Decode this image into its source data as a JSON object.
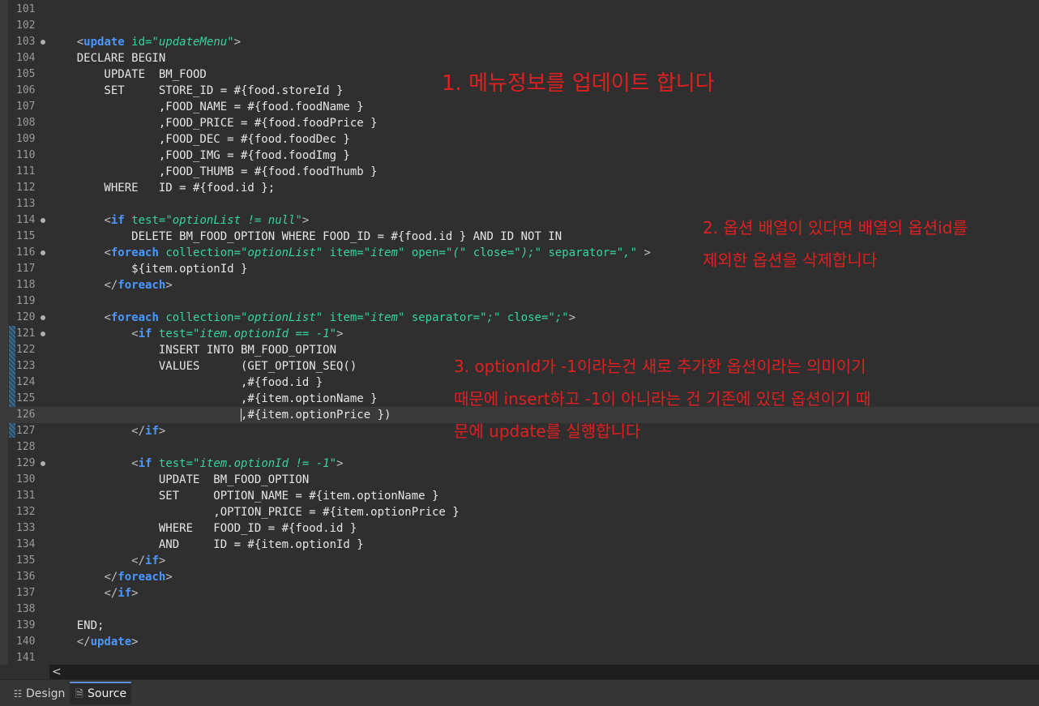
{
  "editor": {
    "lines": [
      {
        "n": "101",
        "html": ""
      },
      {
        "n": "102",
        "html": ""
      },
      {
        "n": "103",
        "fold": true,
        "html": "    <span class=\"tg\">&lt;</span><span class=\"kw\">update</span> <span class=\"at\">id=</span><span class=\"vl\">\"updateMenu\"</span><span class=\"tg\">&gt;</span>"
      },
      {
        "n": "104",
        "html": "    DECLARE BEGIN"
      },
      {
        "n": "105",
        "html": "        UPDATE  BM_FOOD"
      },
      {
        "n": "106",
        "html": "        SET     STORE_ID = #{food.storeId }"
      },
      {
        "n": "107",
        "html": "                ,FOOD_NAME = #{food.foodName }"
      },
      {
        "n": "108",
        "html": "                ,FOOD_PRICE = #{food.foodPrice }"
      },
      {
        "n": "109",
        "html": "                ,FOOD_DEC = #{food.foodDec }"
      },
      {
        "n": "110",
        "html": "                ,FOOD_IMG = #{food.foodImg }"
      },
      {
        "n": "111",
        "html": "                ,FOOD_THUMB = #{food.foodThumb }"
      },
      {
        "n": "112",
        "html": "        WHERE   ID = #{food.id };"
      },
      {
        "n": "113",
        "html": ""
      },
      {
        "n": "114",
        "fold": true,
        "html": "        <span class=\"tg\">&lt;</span><span class=\"kw\">if</span> <span class=\"at\">test=</span><span class=\"vl\">\"optionList != null\"</span><span class=\"tg\">&gt;</span>"
      },
      {
        "n": "115",
        "html": "            DELETE BM_FOOD_OPTION WHERE FOOD_ID = #{food.id } AND ID NOT IN"
      },
      {
        "n": "116",
        "fold": true,
        "html": "        <span class=\"tg\">&lt;</span><span class=\"kw\">foreach</span> <span class=\"at\">collection=</span><span class=\"vl\">\"optionList\"</span> <span class=\"at\">item=</span><span class=\"vl\">\"item\"</span> <span class=\"at\">open=</span><span class=\"vl\">\"(\"</span> <span class=\"at\">close=</span><span class=\"vl\">\");\"</span> <span class=\"at\">separator=</span><span class=\"vl\">\",\"</span> <span class=\"tg\">&gt;</span>"
      },
      {
        "n": "117",
        "html": "            ${item.optionId }"
      },
      {
        "n": "118",
        "html": "        <span class=\"tg\">&lt;/</span><span class=\"kw\">foreach</span><span class=\"tg\">&gt;</span>"
      },
      {
        "n": "119",
        "html": ""
      },
      {
        "n": "120",
        "fold": true,
        "html": "        <span class=\"tg\">&lt;</span><span class=\"kw\">foreach</span> <span class=\"at\">collection=</span><span class=\"vl\">\"optionList\"</span> <span class=\"at\">item=</span><span class=\"vl\">\"item\"</span> <span class=\"at\">separator=</span><span class=\"vl\">\";\"</span> <span class=\"at\">close=</span><span class=\"vl\">\";\"</span><span class=\"tg\">&gt;</span>"
      },
      {
        "n": "121",
        "fold": true,
        "html": "            <span class=\"tg\">&lt;</span><span class=\"kw\">if</span> <span class=\"at\">test=</span><span class=\"vl\">\"item.optionId == -1\"</span><span class=\"tg\">&gt;</span>"
      },
      {
        "n": "122",
        "html": "                INSERT INTO BM_FOOD_OPTION"
      },
      {
        "n": "123",
        "html": "                VALUES      (GET_OPTION_SEQ()"
      },
      {
        "n": "124",
        "html": "                            ,#{food.id }"
      },
      {
        "n": "125",
        "html": "                            ,#{item.optionName }"
      },
      {
        "n": "126",
        "current": true,
        "html": "                            <span class=\"caret\"></span>,#{item.optionPrice })"
      },
      {
        "n": "127",
        "html": "            <span class=\"tg\">&lt;/</span><span class=\"kw\">if</span><span class=\"tg\">&gt;</span>"
      },
      {
        "n": "128",
        "html": ""
      },
      {
        "n": "129",
        "fold": true,
        "html": "            <span class=\"tg\">&lt;</span><span class=\"kw\">if</span> <span class=\"at\">test=</span><span class=\"vl\">\"item.optionId != -1\"</span><span class=\"tg\">&gt;</span>"
      },
      {
        "n": "130",
        "html": "                UPDATE  BM_FOOD_OPTION"
      },
      {
        "n": "131",
        "html": "                SET     OPTION_NAME = #{item.optionName }"
      },
      {
        "n": "132",
        "html": "                        ,OPTION_PRICE = #{item.optionPrice }"
      },
      {
        "n": "133",
        "html": "                WHERE   FOOD_ID = #{food.id }"
      },
      {
        "n": "134",
        "html": "                AND     ID = #{item.optionId }"
      },
      {
        "n": "135",
        "html": "            <span class=\"tg\">&lt;/</span><span class=\"kw\">if</span><span class=\"tg\">&gt;</span>"
      },
      {
        "n": "136",
        "html": "        <span class=\"tg\">&lt;/</span><span class=\"kw\">foreach</span><span class=\"tg\">&gt;</span>"
      },
      {
        "n": "137",
        "html": "        <span class=\"tg\">&lt;/</span><span class=\"kw\">if</span><span class=\"tg\">&gt;</span>"
      },
      {
        "n": "138",
        "html": ""
      },
      {
        "n": "139",
        "html": "    END;"
      },
      {
        "n": "140",
        "html": "    <span class=\"tg\">&lt;/</span><span class=\"kw\">update</span><span class=\"tg\">&gt;</span>"
      },
      {
        "n": "141",
        "html": ""
      }
    ]
  },
  "annotations": {
    "note1": "1. 메뉴정보를 업데이트 합니다",
    "note2": [
      "2. 옵션 배열이 있다면 배열의 옵션id를",
      "제외한 옵션을 삭제합니다"
    ],
    "note3": [
      "3. optionId가 -1이라는건 새로 추가한 옵션이라는 의미이기",
      "때문에 insert하고 -1이 아니라는 건 기존에 있던 옵션이기 때",
      "문에 update를 실행합니다"
    ]
  },
  "scrollbar": {
    "left_arrow": "<"
  },
  "tabs": [
    {
      "label": "Design",
      "icon": "design-icon",
      "active": false
    },
    {
      "label": "Source",
      "icon": "source-file-icon",
      "active": true
    }
  ]
}
